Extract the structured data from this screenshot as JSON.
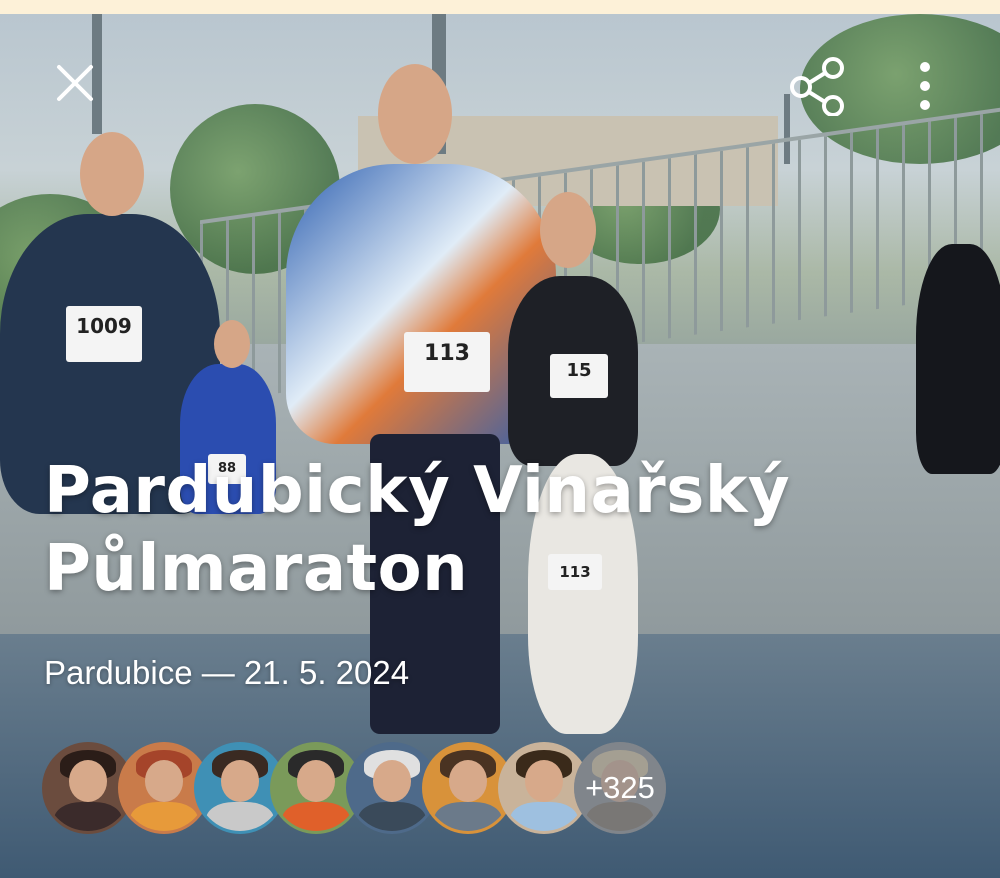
{
  "event": {
    "title_line1": "Pardubický Vinařský",
    "title_line2": "Půlmaraton",
    "subtitle": "Pardubice — 21. 5. 2024"
  },
  "toolbar": {
    "close_icon": "close-icon",
    "share_icon": "share-icon",
    "more_icon": "more-vertical-icon"
  },
  "participants": {
    "avatars": [
      {
        "name": "avatar-1",
        "hair": "#2b1d18",
        "body": "#3b2b2b",
        "bg": "#6b4c3e"
      },
      {
        "name": "avatar-2",
        "hair": "#a5442a",
        "body": "#e79a3a",
        "bg": "#c97b4a"
      },
      {
        "name": "avatar-3",
        "hair": "#3a2a22",
        "body": "#c9c9c9",
        "bg": "#3f90b5"
      },
      {
        "name": "avatar-4",
        "hair": "#2a2a2a",
        "body": "#e0602a",
        "bg": "#7a9a5a"
      },
      {
        "name": "avatar-5",
        "hair": "#e0e0e0",
        "body": "#3a4a5a",
        "bg": "#4e6a8a"
      },
      {
        "name": "avatar-6",
        "hair": "#4a3322",
        "body": "#6b7a8a",
        "bg": "#d8923a"
      },
      {
        "name": "avatar-7",
        "hair": "#3a2a1a",
        "body": "#9ec0e0",
        "bg": "#c9b39a"
      },
      {
        "name": "avatar-8",
        "hair": "#d9c49a",
        "body": "#7a6a5a",
        "bg": "#8a8a8a"
      }
    ],
    "more_count": "+325"
  },
  "bibs": {
    "runner_left": "1009",
    "runner_center": "113",
    "runner_right": "15",
    "runner_back": "88",
    "dog": "113"
  },
  "colors": {
    "top_strip": "#fdf1d8",
    "text": "#ffffff"
  }
}
